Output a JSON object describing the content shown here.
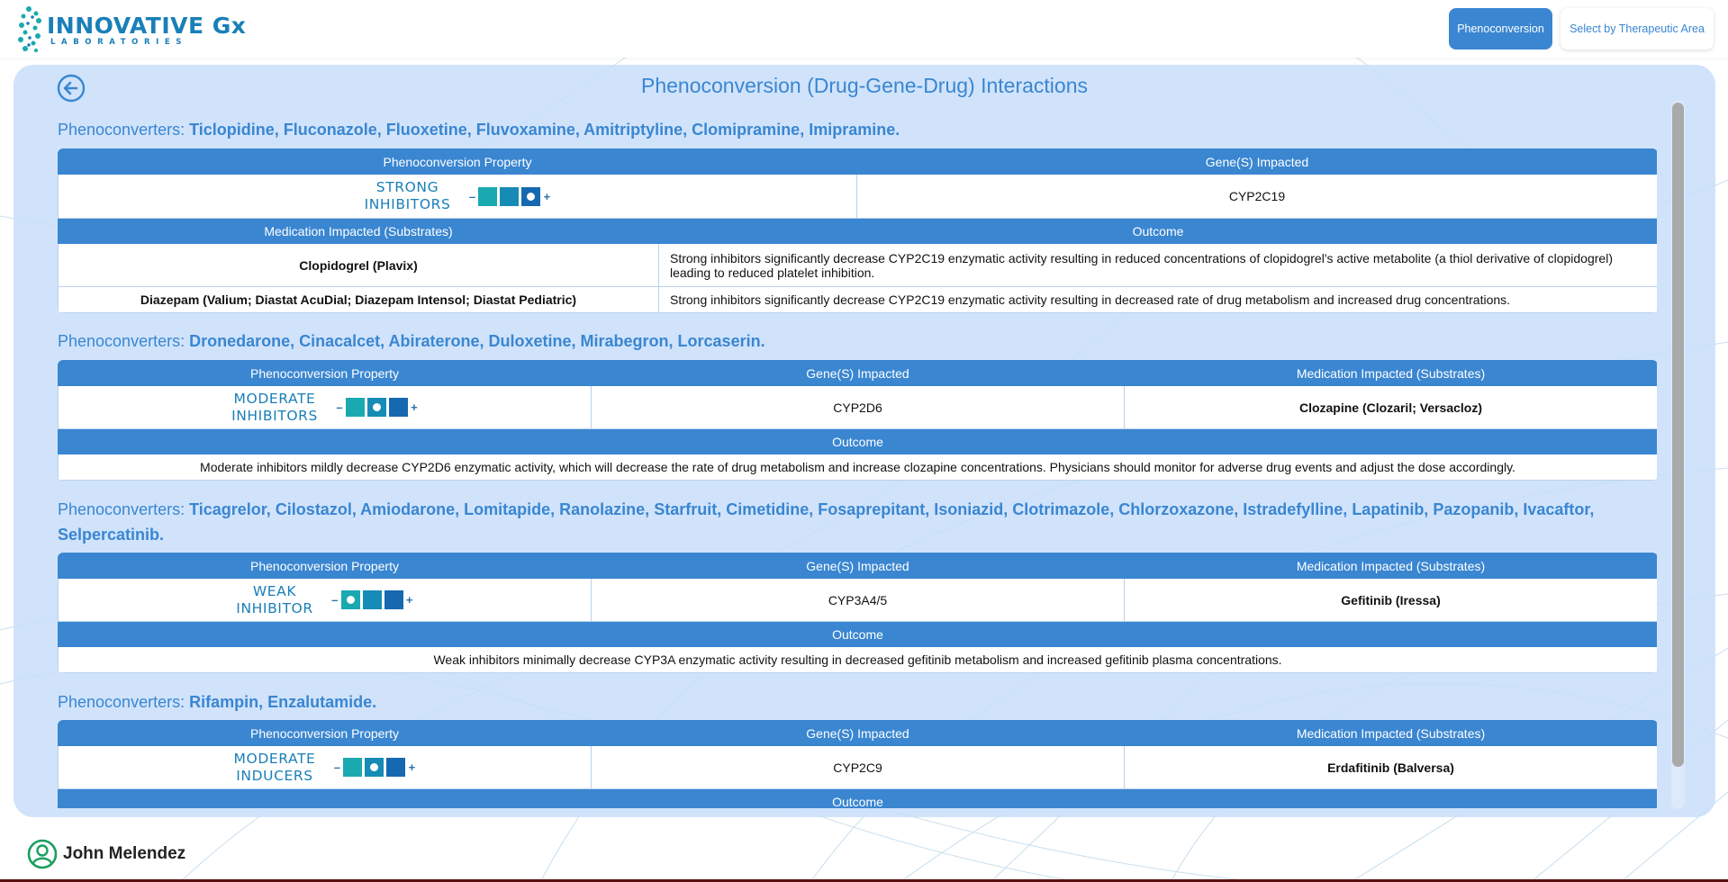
{
  "header": {
    "logo_main": "INNOVATIVE Gx",
    "logo_sub": "LABORATORIES",
    "nav": [
      {
        "label": "Phenoconversion"
      },
      {
        "label": "Select by Therapeutic Area"
      }
    ]
  },
  "colors": {
    "accent": "#3a86d1",
    "panel_bg": "#c8defa",
    "teal": "#1aa9b0",
    "dark_blue": "#1668b0"
  },
  "page": {
    "title": "Phenoconversion (Drug-Gene-Drug) Interactions",
    "back_icon": "arrow-left-circle-icon"
  },
  "headers": {
    "property": "Phenoconversion Property",
    "gene": "Gene(S) Impacted",
    "medication": "Medication Impacted (Substrates)",
    "outcome": "Outcome"
  },
  "sections": [
    {
      "prefix": "Phenoconverters: ",
      "drugs": "Ticlopidine, Fluconazole, Fluoxetine, Fluvoxamine, Amitriptyline, Clomipramine, Imipramine.",
      "property_line1": "STRONG",
      "property_line2": "INHIBITORS",
      "gene": "CYP2C19",
      "rows": [
        {
          "medication": "Clopidogrel (Plavix)",
          "outcome": "Strong inhibitors significantly decrease CYP2C19 enzymatic activity resulting in reduced concentrations of clopidogrel's active metabolite (a thiol derivative of clopidogrel) leading to reduced platelet inhibition."
        },
        {
          "medication": "Diazepam (Valium; Diastat AcuDial; Diazepam Intensol; Diastat Pediatric)",
          "outcome": "Strong inhibitors significantly decrease CYP2C19 enzymatic activity resulting in decreased rate of drug metabolism and increased drug concentrations."
        }
      ]
    },
    {
      "prefix": "Phenoconverters: ",
      "drugs": "Dronedarone, Cinacalcet, Abiraterone, Duloxetine, Mirabegron, Lorcaserin.",
      "property_line1": "MODERATE",
      "property_line2": "INHIBITORS",
      "gene": "CYP2D6",
      "medication": "Clozapine (Clozaril; Versacloz)",
      "outcome": "Moderate inhibitors mildly decrease CYP2D6 enzymatic activity, which will decrease the rate of drug metabolism and increase clozapine concentrations. Physicians should monitor for adverse drug events and adjust the dose accordingly."
    },
    {
      "prefix": "Phenoconverters: ",
      "drugs": "Ticagrelor, Cilostazol, Amiodarone, Lomitapide, Ranolazine, Starfruit, Cimetidine, Fosaprepitant, Isoniazid, Clotrimazole, Chlorzoxazone, Istradefylline, Lapatinib, Pazopanib, Ivacaftor, Selpercatinib.",
      "property_line1": "WEAK",
      "property_line2": "INHIBITOR",
      "gene": "CYP3A4/5",
      "medication": "Gefitinib (Iressa)",
      "outcome": "Weak inhibitors minimally decrease CYP3A enzymatic activity resulting in decreased gefitinib metabolism and increased gefitinib plasma concentrations."
    },
    {
      "prefix": "Phenoconverters: ",
      "drugs": "Rifampin, Enzalutamide.",
      "property_line1": "MODERATE",
      "property_line2": "INDUCERS",
      "gene": "CYP2C9",
      "medication": "Erdafitinib (Balversa)"
    }
  ],
  "signs": {
    "minus": "–",
    "plus": "+"
  },
  "user": {
    "name": "John Melendez",
    "icon": "user-circle-icon"
  }
}
